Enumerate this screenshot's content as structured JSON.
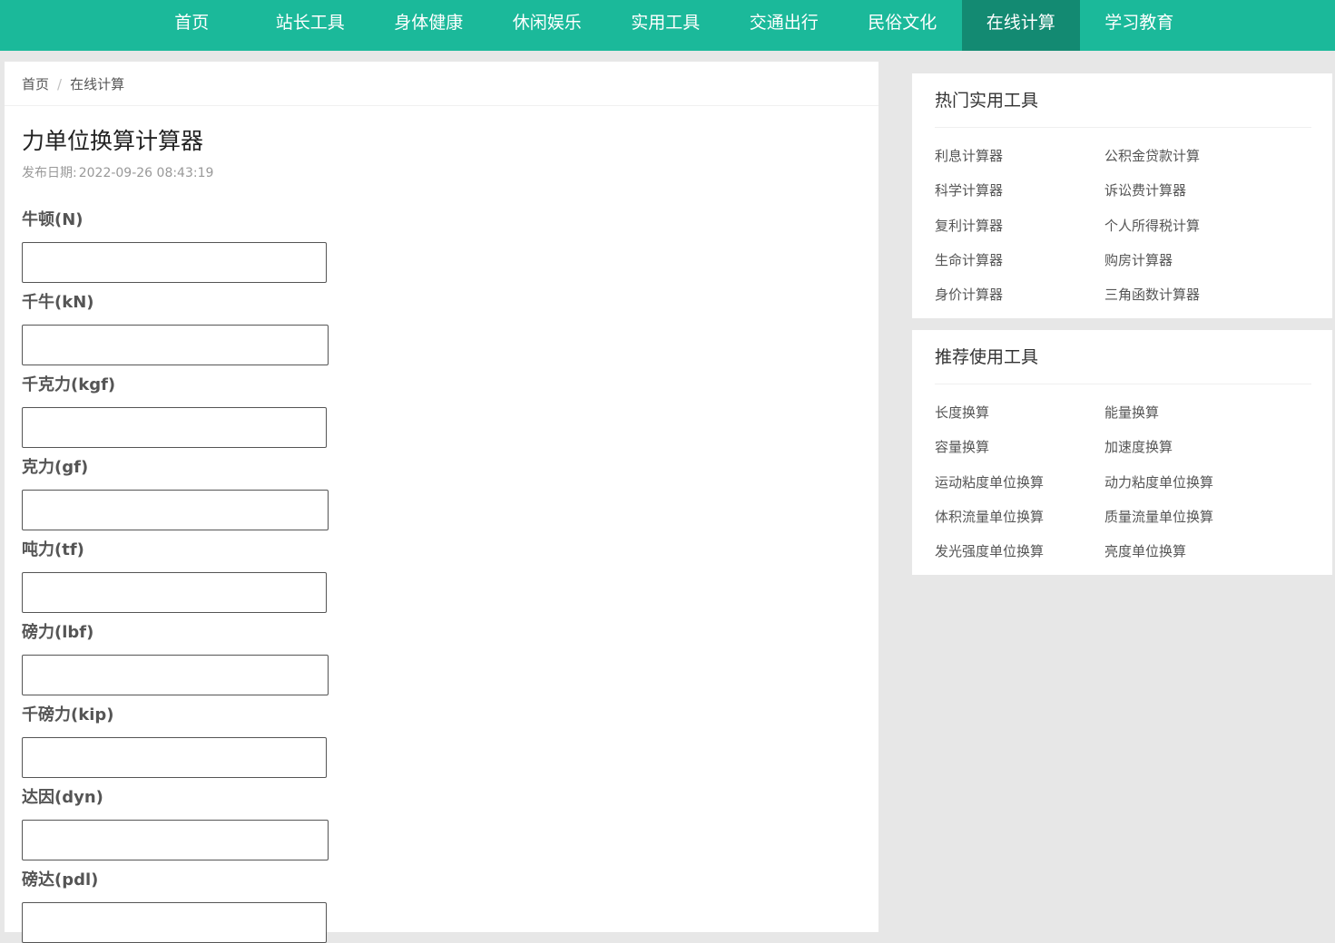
{
  "nav": {
    "items": [
      "首页",
      "站长工具",
      "身体健康",
      "休闲娱乐",
      "实用工具",
      "交通出行",
      "民俗文化",
      "在线计算",
      "学习教育"
    ],
    "active_index": 7
  },
  "breadcrumb": {
    "home": "首页",
    "separator": "/",
    "current": "在线计算"
  },
  "page": {
    "title": "力单位换算计算器",
    "date_label": "发布日期:",
    "date_value": "2022-09-26 08:43:19"
  },
  "fields": [
    {
      "label": "牛顿(N)",
      "value": ""
    },
    {
      "label": "千牛(kN)",
      "value": ""
    },
    {
      "label": "千克力(kgf)",
      "value": ""
    },
    {
      "label": "克力(gf)",
      "value": ""
    },
    {
      "label": "吨力(tf)",
      "value": ""
    },
    {
      "label": "磅力(lbf)",
      "value": ""
    },
    {
      "label": "千磅力(kip)",
      "value": ""
    },
    {
      "label": "达因(dyn)",
      "value": ""
    },
    {
      "label": "磅达(pdl)",
      "value": ""
    }
  ],
  "sidebar": {
    "hot": {
      "title": "热门实用工具",
      "items": [
        "利息计算器",
        "公积金贷款计算",
        "科学计算器",
        "诉讼费计算器",
        "复利计算器",
        "个人所得税计算",
        "生命计算器",
        "购房计算器",
        "身价计算器",
        "三角函数计算器"
      ]
    },
    "recommended": {
      "title": "推荐使用工具",
      "items": [
        "长度换算",
        "能量换算",
        "容量换算",
        "加速度换算",
        "运动粘度单位换算",
        "动力粘度单位换算",
        "体积流量单位换算",
        "质量流量单位换算",
        "发光强度单位换算",
        "亮度单位换算"
      ]
    }
  },
  "colors": {
    "nav_bg": "#1bb99a",
    "nav_active": "#138a72",
    "page_bg": "#e7e7e7"
  }
}
